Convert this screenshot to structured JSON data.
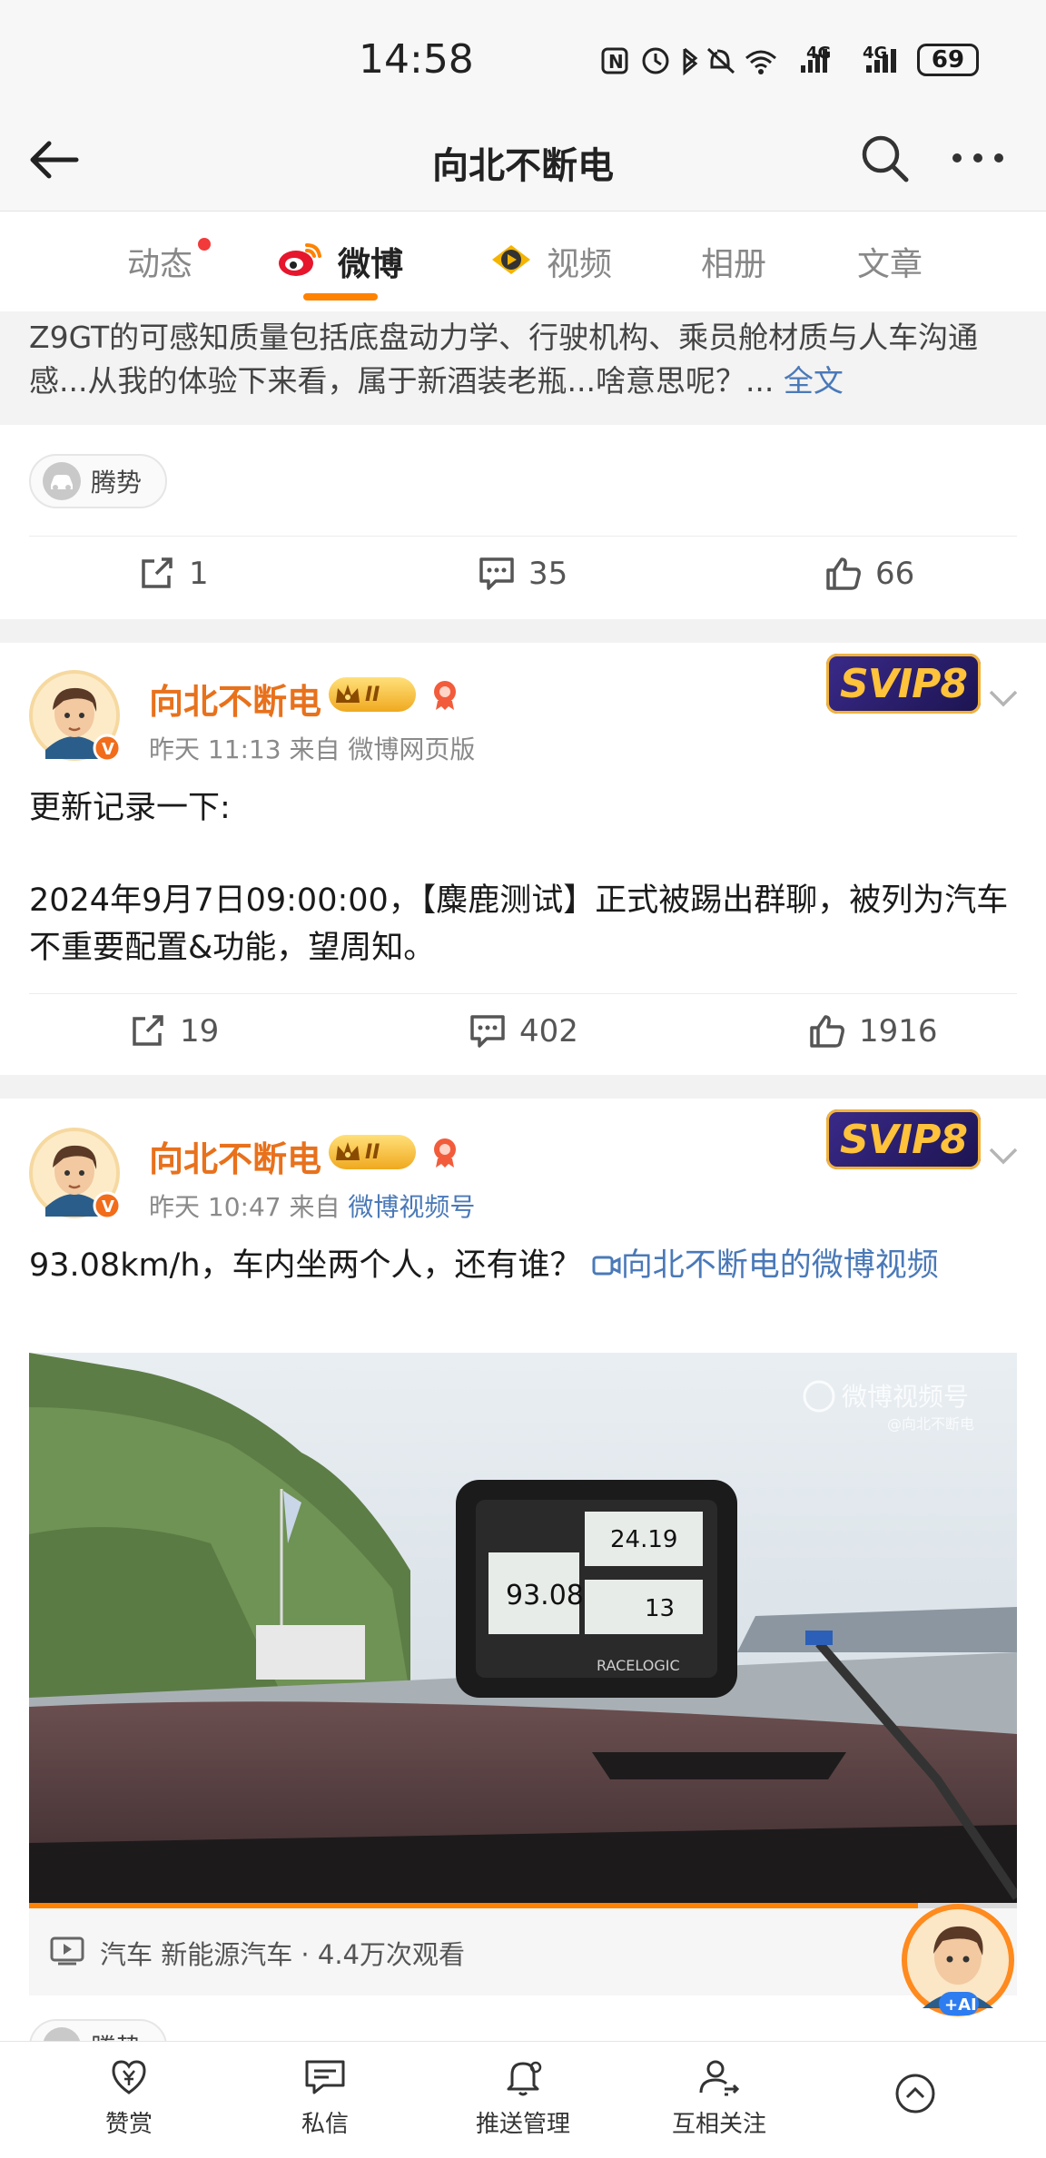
{
  "status_bar": {
    "time": "14:58",
    "battery": "69",
    "net1": "4G",
    "net2": "4G"
  },
  "nav": {
    "title": "向北不断电"
  },
  "tabs": [
    {
      "label": "动态"
    },
    {
      "label": "微博"
    },
    {
      "label": "视频"
    },
    {
      "label": "相册"
    },
    {
      "label": "文章"
    }
  ],
  "post0": {
    "text": "Z9GT的可感知质量包括底盘动力学、行驶机构、乘员舱材质与人车沟通感...从我的体验下来看，属于新酒装老瓶...啥意思呢？...",
    "more": "全文",
    "topic": "腾势",
    "reposts": "1",
    "comments": "35",
    "likes": "66"
  },
  "post1": {
    "author": "向北不断电",
    "level": "II",
    "time": "昨天 11:13",
    "source_prefix": "来自",
    "source": "微博网页版",
    "svip": "SVIP8",
    "text_line1": "更新记录一下:",
    "text_line2": "2024年9月7日09:00:00，【麋鹿测试】正式被踢出群聊，被列为汽车不重要配置&功能，望周知。",
    "reposts": "19",
    "comments": "402",
    "likes": "1916"
  },
  "post2": {
    "author": "向北不断电",
    "level": "II",
    "time": "昨天 10:47",
    "source_prefix": "来自",
    "source": "微博视频号",
    "svip": "SVIP8",
    "text": "93.08km/h，车内坐两个人，还有谁？",
    "video_link": "向北不断电的微博视频",
    "video": {
      "watermark": "微博视频号",
      "watermark_sub": "@向北不断电",
      "speed": "93.08",
      "reading2": "24.19",
      "reading3": "13",
      "device_brand": "RACELOGIC",
      "progress": 0.9
    },
    "meta": "汽车 新能源汽车 · 4.4万次观看",
    "topic": "腾势"
  },
  "ai_badge": "+AI",
  "bottom_bar": [
    {
      "label": "赞赏"
    },
    {
      "label": "私信"
    },
    {
      "label": "推送管理"
    },
    {
      "label": "互相关注"
    },
    {
      "label": ""
    }
  ]
}
